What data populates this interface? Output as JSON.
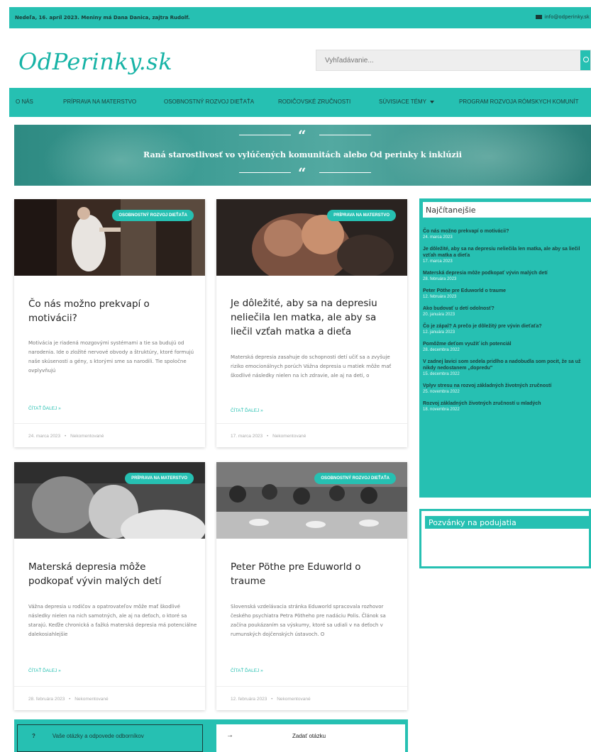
{
  "topbar": {
    "date_text": "Nedeľa, 16. apríl 2023. Meniny má Dana Danica, zajtra Rudolf.",
    "email": "info@odperinky.sk",
    "email_icon": "envelope-icon"
  },
  "logo": {
    "text": "OdPerinky.sk"
  },
  "search": {
    "placeholder": "Vyhľadávanie...",
    "icon": "search-icon"
  },
  "nav": {
    "items": [
      "O NÁS",
      "PRÍPRAVA NA MATERSTVO",
      "OSOBNOSTNÝ ROZVOJ DIEŤAŤA",
      "RODIČOVSKÉ ZRUČNOSTI",
      "SÚVISIACE TÉMY",
      "PROGRAM ROZVOJA RÓMSKYCH KOMUNÍT"
    ]
  },
  "hero": {
    "quote_mark": "“",
    "quote": "Raná starostlivosť vo vylúčených komunitách alebo Od perinky k inklúzii",
    "quote_mark_end": "“"
  },
  "posts": [
    {
      "badge": "OSOBNOSTNÝ ROZVOJ DIEŤAŤA",
      "title": "Čo nás možno prekvapí o motivácii?",
      "excerpt": "Motivácia je riadená mozgovými systémami a tie sa budujú od narodenia. Ide o zložité nervové obvody a štruktúry, ktoré formujú naše skúsenosti a gény, s ktorými sme sa narodili. Tie spoločne ovplyvňujú",
      "read_more": "ČÍTAŤ ĎALEJ »",
      "date": "24. marca 2023",
      "comments": "Nekomentované"
    },
    {
      "badge": "PRÍPRAVA NA MATERSTVO",
      "title": "Je dôležité, aby sa na depresiu neliečila len matka, ale aby sa liečil vzťah matka a dieťa",
      "excerpt": "Materská depresia zasahuje do schopnosti detí učiť sa a zvyšuje riziko emocionálnych porúch Vážna depresia u matiek môže mať škodlivé následky nielen na ich zdravie, ale aj na deti, o",
      "read_more": "ČÍTAŤ ĎALEJ »",
      "date": "17. marca 2023",
      "comments": "Nekomentované"
    },
    {
      "badge": "PRÍPRAVA NA MATERSTVO",
      "title": "Materská depresia môže podkopať vývin malých detí",
      "excerpt": "Vážna depresia u rodičov a opatrovateľov môže mať škodlivé následky nielen na nich samotných, ale aj na deťoch, o ktoré sa starajú. Keďže chronická a ťažká materská depresia má potenciálne dalekosiahlejšie",
      "read_more": "ČÍTAŤ ĎALEJ »",
      "date": "28. februára 2023",
      "comments": "Nekomentované"
    },
    {
      "badge": "OSOBNOSTNÝ ROZVOJ DIEŤAŤA",
      "title": "Peter Pöthe pre Eduworld o traume",
      "excerpt": "Slovenská vzdelávacia stránka Eduworld spracovala rozhovor českého psychiatra Petra Pötheho pre nadáciu Polis. Článok sa začína poukázaním sa výskumy, ktoré sa udiali v na deťoch v rumunských dojčenských ústavoch. O",
      "read_more": "ČÍTAŤ ĎALEJ »",
      "date": "12. februára 2023",
      "comments": "Nekomentované"
    }
  ],
  "meta_separator": "•",
  "sidebar_popular": {
    "title": "Najčítanejšie",
    "items": [
      {
        "title": "Čo nás možno prekvapí o motivácii?",
        "date": "24. marca 2023"
      },
      {
        "title": "Je dôležité, aby sa na depresiu neliečila len matka, ale aby sa liečil vzťah matka a dieťa",
        "date": "17. marca 2023"
      },
      {
        "title": "Materská depresia môže podkopať vývin malých detí",
        "date": "28. februára 2023"
      },
      {
        "title": "Peter Pöthe pre Eduworld o traume",
        "date": "12. februára 2023"
      },
      {
        "title": "Ako budovať u detí odolnosť?",
        "date": "20. januára 2023"
      },
      {
        "title": "Čo je zápal? A prečo je dôležitý pre vývin dieťaťa?",
        "date": "12. januára 2023"
      },
      {
        "title": "Pomôžme deťom využiť ich potenciál",
        "date": "28. decembra 2022"
      },
      {
        "title": "V zadnej lavici som sedela pridlho a nadobudla som pocit, že sa už nikdy nedostanem „dopredu\"",
        "date": "15. decembra 2022"
      },
      {
        "title": "Vplyv stresu na rozvoj základných životných zručností",
        "date": "25. novembra 2022"
      },
      {
        "title": "Rozvoj základných životných zručností u mladých",
        "date": "18. novembra 2022"
      }
    ]
  },
  "sidebar_events": {
    "title": "Pozvánky na podujatia"
  },
  "bottom": {
    "question_mark": "?",
    "left_label": "Vaše otázky a odpovede odborníkov",
    "arrow": "→",
    "right_label": "Zadať otázku"
  },
  "colors": {
    "accent": "#26c0b2",
    "dark_text": "#1b3b38"
  }
}
